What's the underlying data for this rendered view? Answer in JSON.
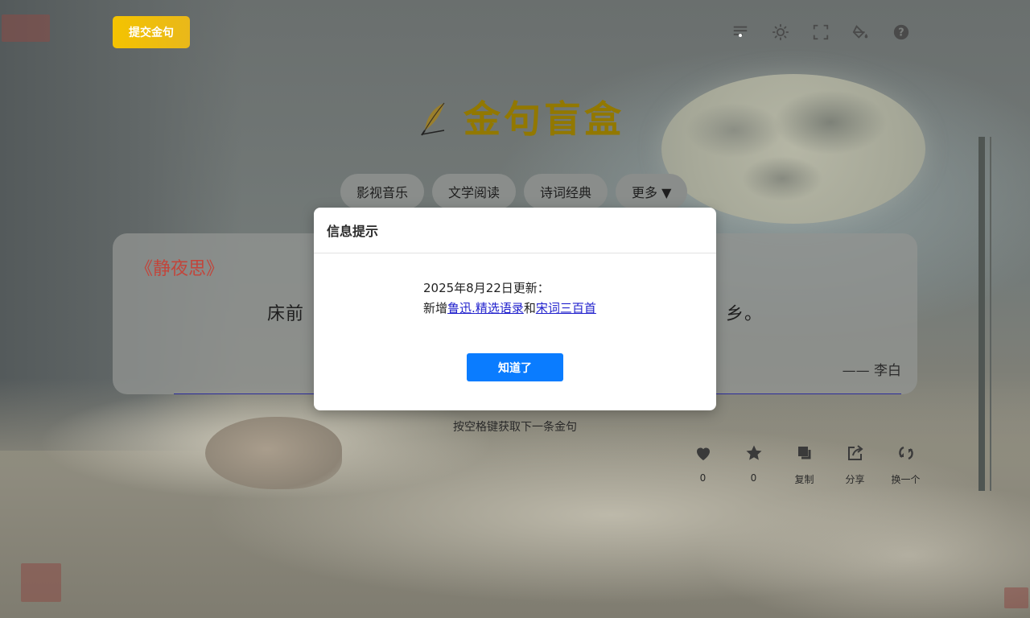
{
  "header": {
    "submit_label": "提交金句"
  },
  "toolbar": {
    "icons": [
      "list-theme-icon",
      "brightness-icon",
      "fullscreen-icon",
      "paint-bucket-icon",
      "help-icon"
    ]
  },
  "brand": {
    "title": "金句盲盒",
    "icon": "quill-feather-icon"
  },
  "categories": [
    {
      "label": "影视音乐"
    },
    {
      "label": "文学阅读"
    },
    {
      "label": "诗词经典"
    },
    {
      "label": "更多 ▼"
    }
  ],
  "quote": {
    "title": "《静夜思》",
    "body_start": "床前",
    "body_end": "乡。",
    "author": "—— 李白"
  },
  "hint": "按空格键获取下一条金句",
  "actions": [
    {
      "icon": "heart-icon",
      "label": "0"
    },
    {
      "icon": "star-icon",
      "label": "0"
    },
    {
      "icon": "copy-icon",
      "label": "复制"
    },
    {
      "icon": "share-icon",
      "label": "分享"
    },
    {
      "icon": "refresh-icon",
      "label": "换一个"
    }
  ],
  "modal": {
    "title": "信息提示",
    "line1": "2025年8月22日更新：",
    "prefix": "新增",
    "link1": "鲁迅",
    "sep": ".",
    "link2": "精选语录",
    "joiner": "和",
    "link3": "宋词三百首",
    "ok_label": "知道了"
  },
  "colors": {
    "accent_yellow": "#f4c300",
    "brand_gold": "#927800",
    "poem_title_red": "#c2453b",
    "primary_blue": "#0a7cff"
  }
}
